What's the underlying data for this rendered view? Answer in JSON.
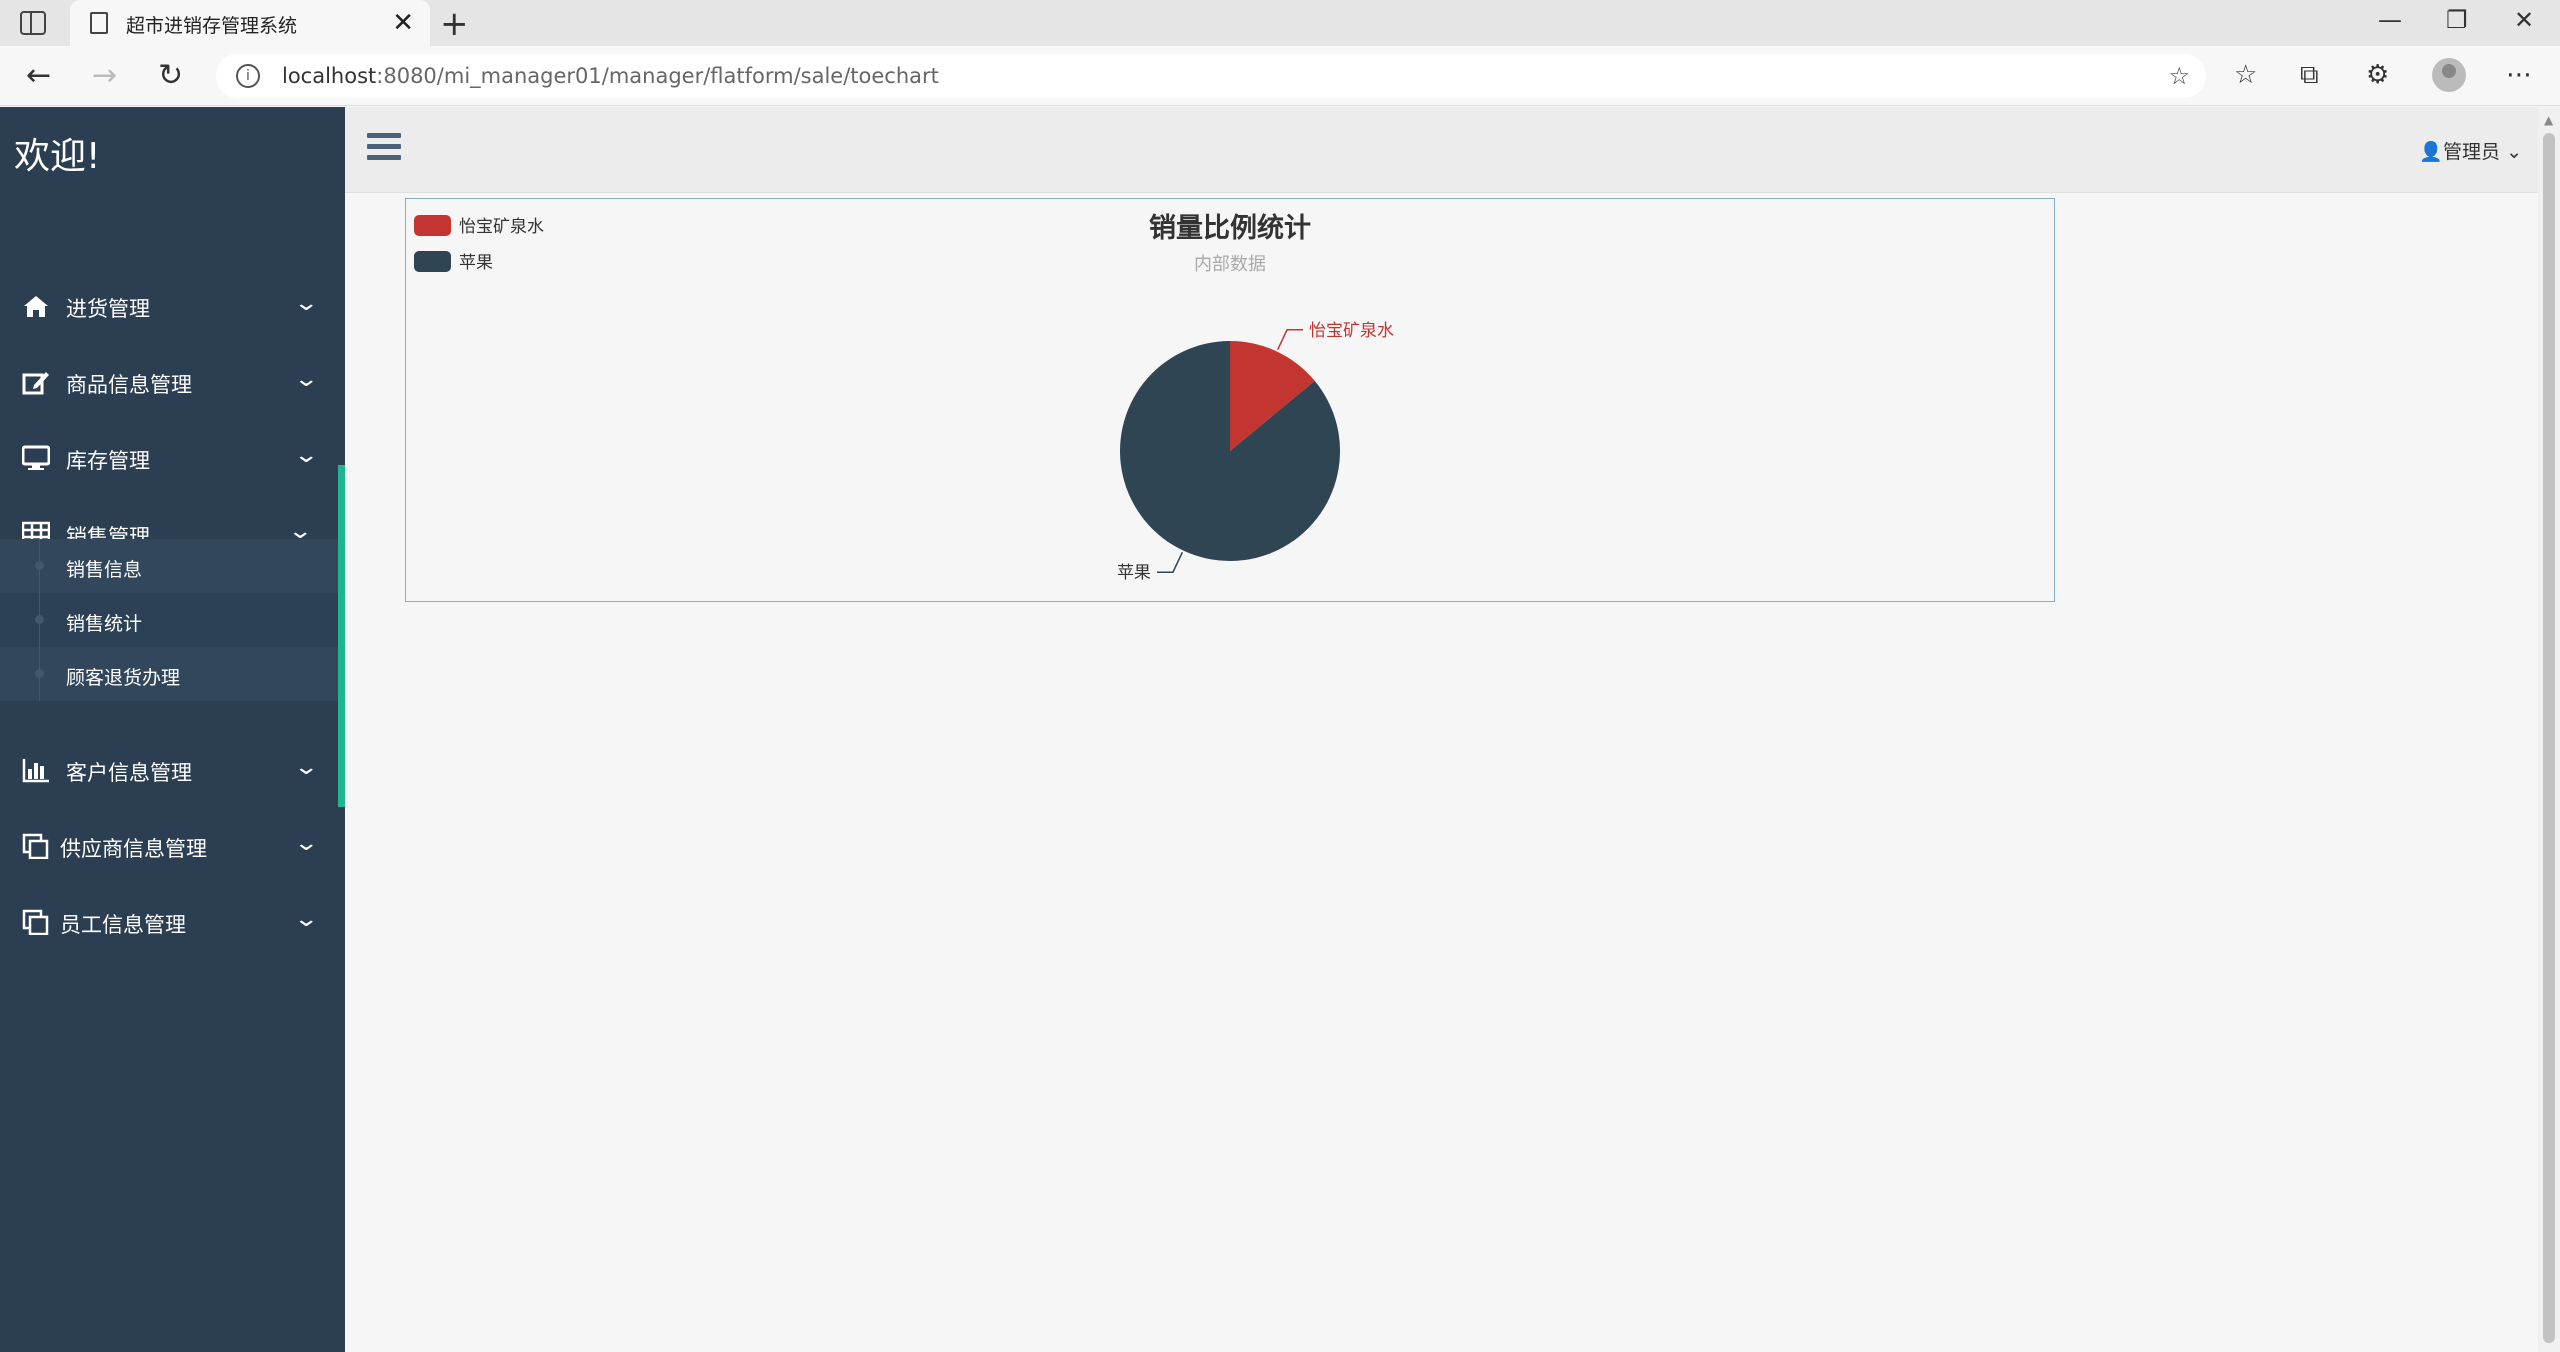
{
  "browser": {
    "tab_title": "超市进销存管理系统",
    "url_host": "localhost",
    "url_rest": ":8080/mi_manager01/manager/flatform/sale/toechart",
    "tab_close": "✕",
    "new_tab": "+"
  },
  "sidebar": {
    "welcome": "欢迎!",
    "items": [
      {
        "label": "进货管理",
        "icon": "home-icon"
      },
      {
        "label": "商品信息管理",
        "icon": "edit-icon"
      },
      {
        "label": "库存管理",
        "icon": "monitor-icon"
      },
      {
        "label": "销售管理",
        "icon": "table-icon",
        "expanded": true
      },
      {
        "label": "客户信息管理",
        "icon": "bar-chart-icon"
      },
      {
        "label": "供应商信息管理",
        "icon": "copy-icon"
      },
      {
        "label": "员工信息管理",
        "icon": "copy-icon"
      }
    ],
    "submenu": [
      {
        "label": "销售信息"
      },
      {
        "label": "销售统计",
        "selected": true
      },
      {
        "label": "顾客退货办理"
      }
    ]
  },
  "topbar": {
    "user_label": "管理员"
  },
  "chart_data": {
    "type": "pie",
    "title": "销量比例统计",
    "subtitle": "内部数据",
    "legend_position": "top-left",
    "slices": [
      {
        "name": "怡宝矿泉水",
        "value": 14,
        "color": "#c23531"
      },
      {
        "name": "苹果",
        "value": 86,
        "color": "#2f4554"
      }
    ]
  }
}
